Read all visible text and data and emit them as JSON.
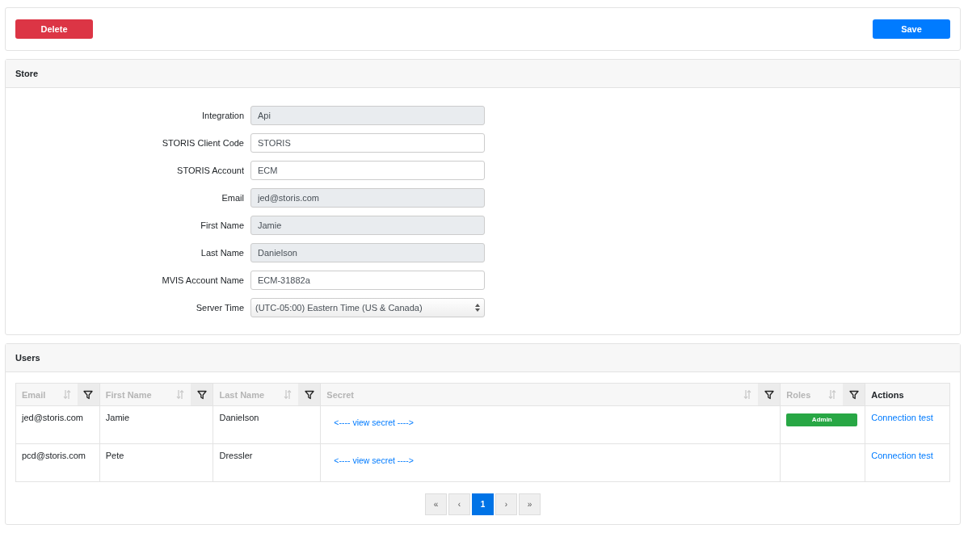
{
  "toolbar": {
    "delete_button": "Delete",
    "save_button": "Save"
  },
  "store": {
    "title": "Store",
    "fields": [
      {
        "label": "Integration",
        "kind": "text",
        "value": "Api",
        "disabled": true
      },
      {
        "label": "STORIS Client Code",
        "kind": "text",
        "value": "STORIS",
        "disabled": false
      },
      {
        "label": "STORIS Account",
        "kind": "text",
        "value": "ECM",
        "disabled": false
      },
      {
        "label": "Email",
        "kind": "text",
        "value": "jed@storis.com",
        "disabled": true
      },
      {
        "label": "First Name",
        "kind": "text",
        "value": "Jamie",
        "disabled": true
      },
      {
        "label": "Last Name",
        "kind": "text",
        "value": "Danielson",
        "disabled": true
      },
      {
        "label": "MVIS Account Name",
        "kind": "text",
        "value": "ECM-31882a",
        "disabled": false
      },
      {
        "label": "Server Time",
        "kind": "select",
        "value": "(UTC-05:00) Eastern Time (US & Canada)",
        "disabled": false
      }
    ]
  },
  "users": {
    "title": "Users",
    "columns": [
      {
        "label": "Email",
        "sortable": true,
        "filterable": true
      },
      {
        "label": "First Name",
        "sortable": true,
        "filterable": true
      },
      {
        "label": "Last Name",
        "sortable": true,
        "filterable": true
      },
      {
        "label": "Secret",
        "sortable": true,
        "filterable": true
      },
      {
        "label": "Roles",
        "sortable": true,
        "filterable": true
      },
      {
        "label": "Actions",
        "sortable": false,
        "filterable": false
      }
    ],
    "rows": [
      {
        "email": "jed@storis.com",
        "first_name": "Jamie",
        "last_name": "Danielson",
        "secret": "<---- view secret ---->",
        "roles": [
          {
            "label": "Admin",
            "color": "#28a745"
          }
        ],
        "action": "Connection test"
      },
      {
        "email": "pcd@storis.com",
        "first_name": "Pete",
        "last_name": "Dressler",
        "secret": "<---- view secret ---->",
        "roles": [],
        "action": "Connection test"
      }
    ],
    "pagination": {
      "first": "«",
      "prev": "‹",
      "pages": [
        {
          "label": "1",
          "selected": true
        }
      ],
      "next": "›",
      "last": "»"
    }
  }
}
